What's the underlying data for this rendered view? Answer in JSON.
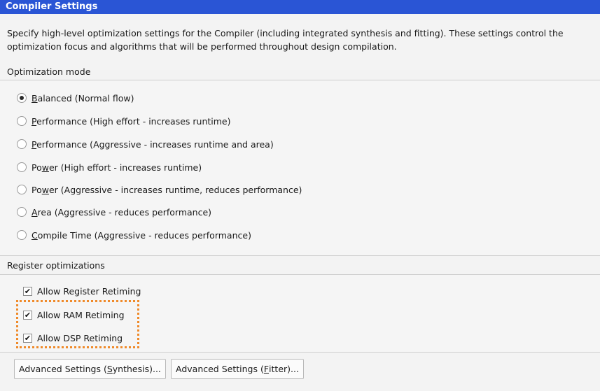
{
  "header": {
    "title": "Compiler Settings"
  },
  "description": {
    "line1": "Specify high-level optimization settings for the Compiler (including integrated synthesis and fitting).  These settings control the",
    "line2": "optimization focus and algorithms that will be performed throughout design compilation."
  },
  "optimization_mode": {
    "label": "Optimization mode",
    "selected": "Balanced (Normal flow)",
    "options": [
      {
        "mnemonic": "B",
        "rest": "alanced (Normal flow)",
        "checked": true
      },
      {
        "mnemonic": "P",
        "rest": "erformance (High effort - increases runtime)",
        "checked": false
      },
      {
        "mnemonic": "P",
        "rest": "erformance (Aggressive - increases runtime and area)",
        "checked": false
      },
      {
        "pre": "Po",
        "mnemonic": "w",
        "rest": "er (High effort - increases runtime)",
        "checked": false
      },
      {
        "pre": "Po",
        "mnemonic": "w",
        "rest": "er (Aggressive - increases runtime, reduces performance)",
        "checked": false
      },
      {
        "mnemonic": "A",
        "rest": "rea (Aggressive - reduces performance)",
        "checked": false
      },
      {
        "mnemonic": "C",
        "rest": "ompile Time (Aggressive - reduces performance)",
        "checked": false
      }
    ]
  },
  "register_optimizations": {
    "label": "Register optimizations",
    "items": [
      {
        "label": "Allow Register Retiming",
        "checked": true,
        "mark": "✔"
      },
      {
        "label": "Allow RAM Retiming",
        "checked": true,
        "mark": "✔"
      },
      {
        "label": "Allow DSP Retiming",
        "checked": true,
        "mark": "✔"
      }
    ]
  },
  "buttons": {
    "synthesis": {
      "pre": "Advanced Settings (",
      "mnemonic": "S",
      "rest": "ynthesis)..."
    },
    "fitter": {
      "pre": "Advanced Settings (",
      "mnemonic": "F",
      "rest": "itter)..."
    }
  },
  "colors": {
    "header_bg": "#2a55d5",
    "highlight_border": "#ef8a2a"
  }
}
